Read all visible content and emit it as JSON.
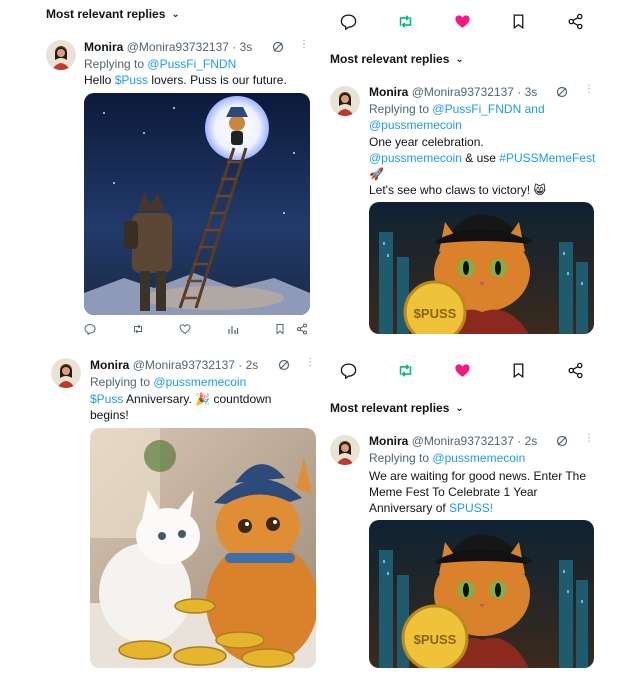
{
  "colors": {
    "link": "#1d9bf0",
    "retweet_active": "#00ba7c",
    "like_active": "#f91880",
    "muted": "#536471"
  },
  "left_top": {
    "header": "Most relevant replies",
    "tweet": {
      "name": "Monira",
      "handle": "@Monira93732137",
      "time": "· 3s",
      "replying_label": "Replying to",
      "replying_to": "@PussFi_FNDN",
      "text_link": "$Puss",
      "text_pre": "Hello",
      "text_post": "lovers. Puss is our future."
    }
  },
  "right_top": {
    "header": "Most relevant replies",
    "tweet": {
      "name": "Monira",
      "handle": "@Monira93732137",
      "time": "· 3s",
      "replying_label": "Replying to",
      "replying_to_1": "@PussFi_FNDN",
      "replying_and": "and",
      "replying_to_2": "@pussmemecoin",
      "line1": "One year celebration.",
      "line2_link1": "@pussmemecoin",
      "line2_mid": "& use",
      "line2_link2": "#PUSSMemeFest",
      "line3_emoji": "🚀",
      "line4": "Let's see who claws to victory! 😸"
    },
    "coin_text": "$PUSS"
  },
  "left_bottom": {
    "tweet": {
      "name": "Monira",
      "handle": "@Monira93732137",
      "time": "· 2s",
      "replying_label": "Replying to",
      "replying_to": "@pussmemecoin",
      "text_link": "$Puss",
      "text_post": "Anniversary. 🎉 countdown",
      "text_line2": "begins!"
    }
  },
  "right_bottom": {
    "header": "Most relevant replies",
    "tweet": {
      "name": "Monira",
      "handle": "@Monira93732137",
      "time": "· 2s",
      "replying_label": "Replying to",
      "replying_to": "@pussmemecoin",
      "line1": "We are waiting for good news. Enter The",
      "line2": "Meme Fest To Celebrate 1 Year",
      "line3_pre": "Anniversary of",
      "line3_link": "SPUSS!"
    },
    "coin_text": "$PUSS"
  },
  "icons": [
    "reply-icon",
    "retweet-icon",
    "like-icon",
    "views-icon",
    "bookmark-icon",
    "share-icon",
    "grok-icon",
    "more-icon",
    "chevron-down-icon"
  ]
}
